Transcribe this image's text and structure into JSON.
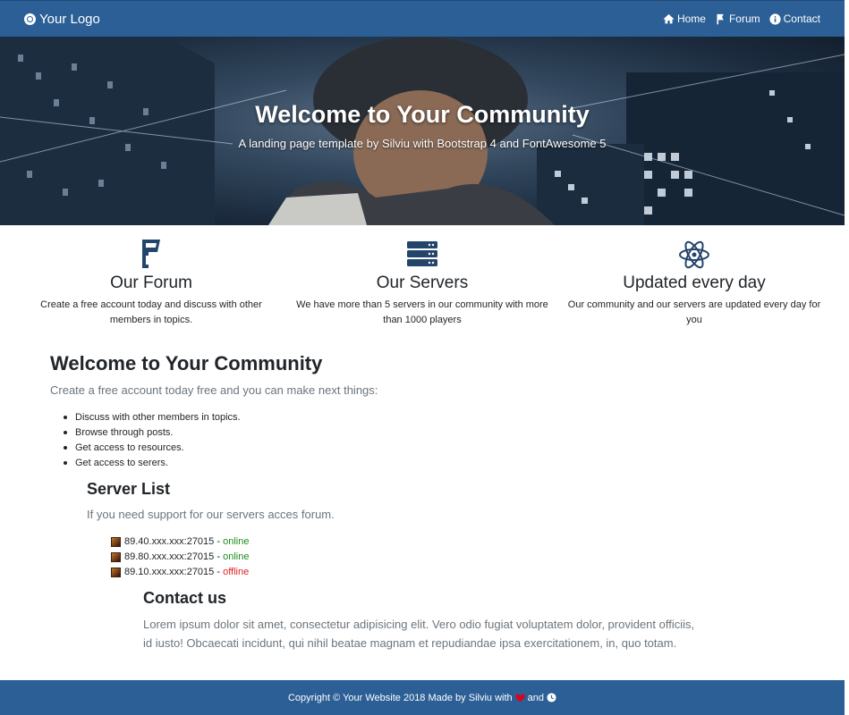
{
  "nav": {
    "brand": "Your Logo",
    "links": [
      {
        "label": "Home",
        "icon": "home-icon"
      },
      {
        "label": "Forum",
        "icon": "flag-icon"
      },
      {
        "label": "Contact",
        "icon": "info-icon"
      }
    ]
  },
  "hero": {
    "title": "Welcome to Your Community",
    "subtitle": "A landing page template by Silviu with Bootstrap 4 and FontAwesome 5"
  },
  "features": [
    {
      "icon": "foursquare-icon",
      "title": "Our Forum",
      "text": "Create a free account today and discuss with other members in topics."
    },
    {
      "icon": "server-icon",
      "title": "Our Servers",
      "text": "We have more than 5 servers in our community with more than 1000 players"
    },
    {
      "icon": "atom-icon",
      "title": "Updated every day",
      "text": "Our community and our servers are updated every day for you"
    }
  ],
  "welcome": {
    "title": "Welcome to Your Community",
    "lead": "Create a free account today free and you can make next things:",
    "items": [
      "Discuss with other members in topics.",
      "Browse through posts.",
      "Get access to resources.",
      "Get access to serers."
    ]
  },
  "servers": {
    "title": "Server List",
    "lead": "If you need support for our servers acces forum.",
    "list": [
      {
        "address": "89.40.xxx.xxx:27015",
        "separator": " - ",
        "status": "online"
      },
      {
        "address": "89.80.xxx.xxx:27015",
        "separator": " - ",
        "status": "online"
      },
      {
        "address": "89.10.xxx.xxx:27015",
        "separator": " - ",
        "status": "offline"
      }
    ]
  },
  "contact": {
    "title": "Contact us",
    "text": "Lorem ipsum dolor sit amet, consectetur adipisicing elit. Vero odio fugiat voluptatem dolor, provident officiis, id iusto! Obcaecati incidunt, qui nihil beatae magnam et repudiandae ipsa exercitationem, in, quo totam."
  },
  "footer": {
    "text": "Copyright © Your Website 2018 Made by Silviu with",
    "and": "and"
  },
  "colors": {
    "brand": "#2b5f96",
    "online": "#1e8e1e",
    "offline": "#e02020",
    "icon": "#24456b",
    "heart": "#e0001b"
  }
}
